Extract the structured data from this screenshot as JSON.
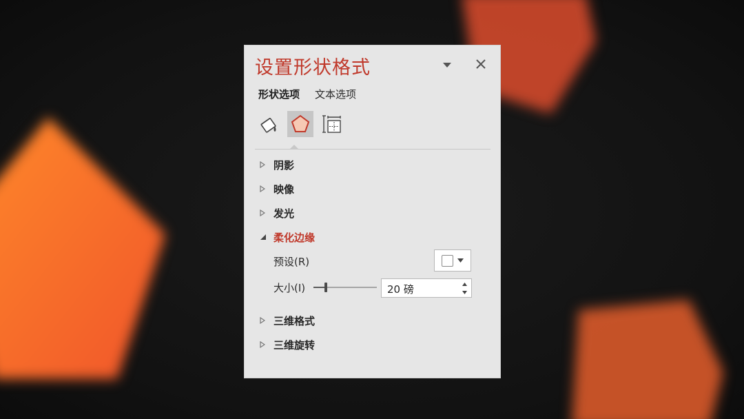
{
  "pane": {
    "title": "设置形状格式",
    "tabs": [
      {
        "label": "形状选项",
        "active": true
      },
      {
        "label": "文本选项",
        "active": false
      }
    ],
    "categories": [
      {
        "icon": "fill-bucket-icon",
        "selected": false
      },
      {
        "icon": "pentagon-effects-icon",
        "selected": true
      },
      {
        "icon": "size-properties-icon",
        "selected": false
      }
    ],
    "sections": [
      {
        "label": "阴影",
        "expanded": false
      },
      {
        "label": "映像",
        "expanded": false
      },
      {
        "label": "发光",
        "expanded": false
      },
      {
        "label": "柔化边缘",
        "expanded": true
      },
      {
        "label": "三维格式",
        "expanded": false
      },
      {
        "label": "三维旋转",
        "expanded": false
      }
    ],
    "soft_edges": {
      "preset_label": "预设(R)",
      "size_label": "大小(I)",
      "size_value": "20 磅",
      "slider_fraction": 0.2
    }
  },
  "colors": {
    "accent": "#c0392b",
    "pane_bg": "#e6e6e6",
    "blob_orange": "#ff7a2e",
    "blob_red": "#e6452a"
  }
}
